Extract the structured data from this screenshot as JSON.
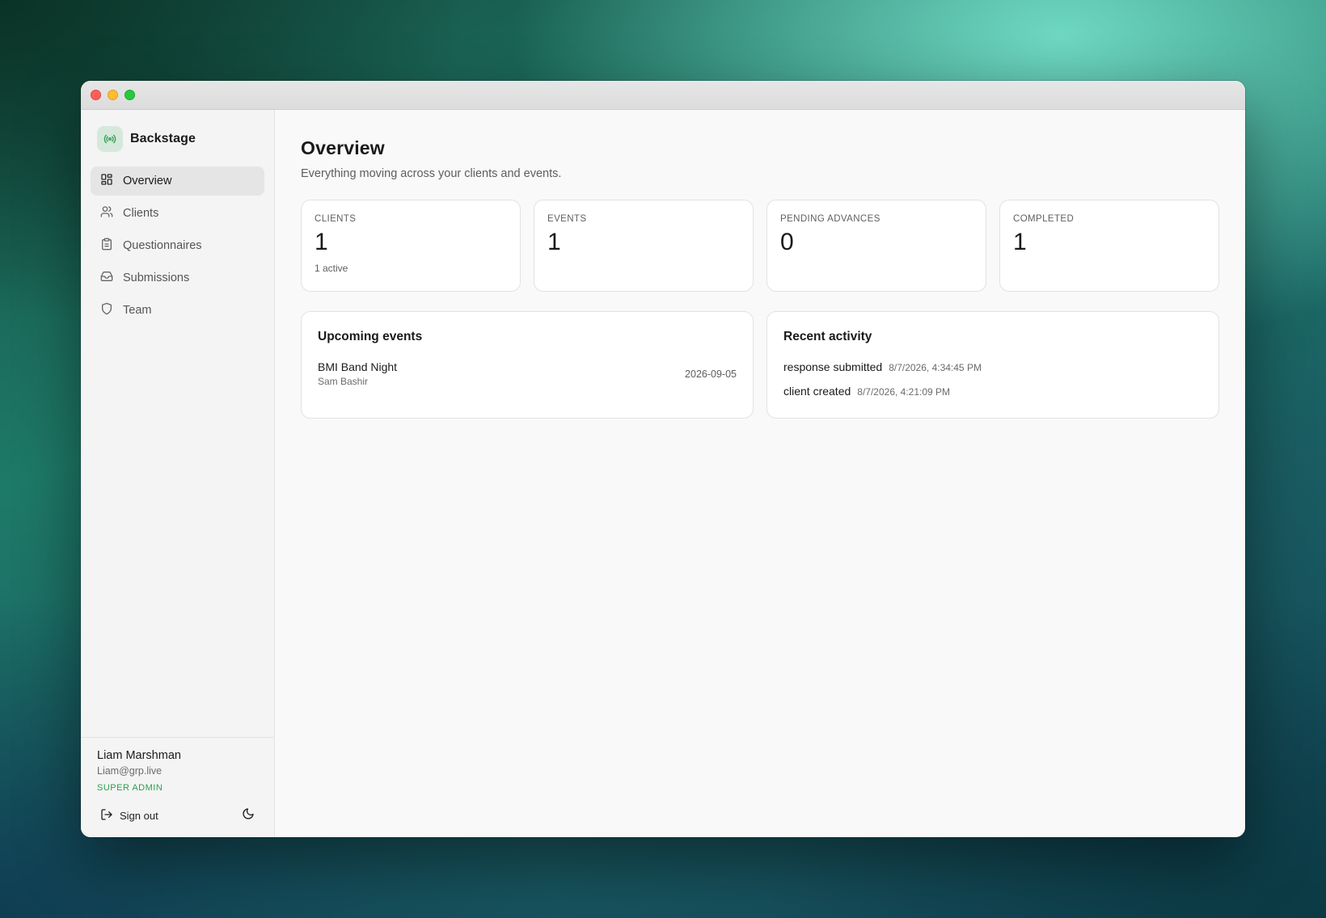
{
  "app": {
    "name": "Backstage",
    "logo_icon": "broadcast-icon",
    "accent": "#2e9e50"
  },
  "sidebar": {
    "items": [
      {
        "label": "Overview",
        "icon": "dashboard-icon",
        "active": true
      },
      {
        "label": "Clients",
        "icon": "users-icon",
        "active": false
      },
      {
        "label": "Questionnaires",
        "icon": "clipboard-icon",
        "active": false
      },
      {
        "label": "Submissions",
        "icon": "inbox-icon",
        "active": false
      },
      {
        "label": "Team",
        "icon": "shield-icon",
        "active": false
      }
    ]
  },
  "user": {
    "name": "Liam Marshman",
    "email": "Liam@grp.live",
    "role": "SUPER ADMIN",
    "signout_label": "Sign out"
  },
  "page": {
    "title": "Overview",
    "subtitle": "Everything moving across your clients and events."
  },
  "stats": [
    {
      "label": "CLIENTS",
      "value": "1",
      "sub": "1 active"
    },
    {
      "label": "EVENTS",
      "value": "1",
      "sub": ""
    },
    {
      "label": "PENDING ADVANCES",
      "value": "0",
      "sub": ""
    },
    {
      "label": "COMPLETED",
      "value": "1",
      "sub": ""
    }
  ],
  "upcoming": {
    "title": "Upcoming events",
    "events": [
      {
        "name": "BMI Band Night",
        "client": "Sam Bashir",
        "date": "2026-09-05"
      }
    ]
  },
  "activity": {
    "title": "Recent activity",
    "items": [
      {
        "text": "response submitted",
        "time": "8/7/2026, 4:34:45 PM"
      },
      {
        "text": "client created",
        "time": "8/7/2026, 4:21:09 PM"
      }
    ]
  }
}
